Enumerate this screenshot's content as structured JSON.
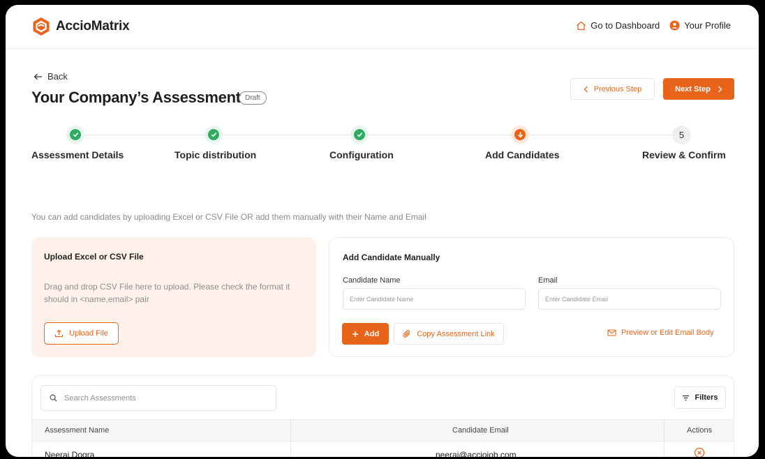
{
  "header": {
    "brand": "AccioMatrix",
    "go_to_dashboard": "Go to Dashboard",
    "your_profile": "Your Profile"
  },
  "page": {
    "back_label": "Back",
    "title": "Your Company’s Assessment",
    "status_badge": "Draft",
    "prev_step_label": "Previous Step",
    "next_step_label": "Next Step"
  },
  "stepper": {
    "steps": [
      {
        "label": "Assessment Details",
        "state": "done"
      },
      {
        "label": "Topic distribution",
        "state": "done"
      },
      {
        "label": "Configuration",
        "state": "done"
      },
      {
        "label": "Add Candidates",
        "state": "active"
      },
      {
        "label": "Review & Confirm",
        "state": "pending",
        "number": "5"
      }
    ]
  },
  "info_text": "You can add candidates by uploading Excel or CSV File OR add them manually with their Name and Email",
  "upload": {
    "title": "Upload Excel or CSV File",
    "description": "Drag and drop CSV File here to upload. Please check the format it should in  <name,email> pair",
    "button_label": "Upload File"
  },
  "manual": {
    "title": "Add Candidate Manually",
    "name_label": "Candidate Name",
    "name_placeholder": "Enter Candidate Name",
    "email_label": "Email",
    "email_placeholder": "Enter Candidate Email",
    "add_label": "Add",
    "copy_link_label": "Copy Assessment Link",
    "preview_email_label": "Preview or Edit Email Body"
  },
  "table": {
    "search_placeholder": "Search Assessments",
    "filters_label": "Filters",
    "columns": [
      "Assessment Name",
      "Candidate Email",
      "Actions"
    ],
    "rows": [
      {
        "name": "Neeraj Dogra",
        "email": "neeraj@acciojob.com"
      }
    ]
  },
  "colors": {
    "accent": "#e8641a",
    "success": "#2faa62",
    "upload_bg": "#fdf1ea"
  }
}
